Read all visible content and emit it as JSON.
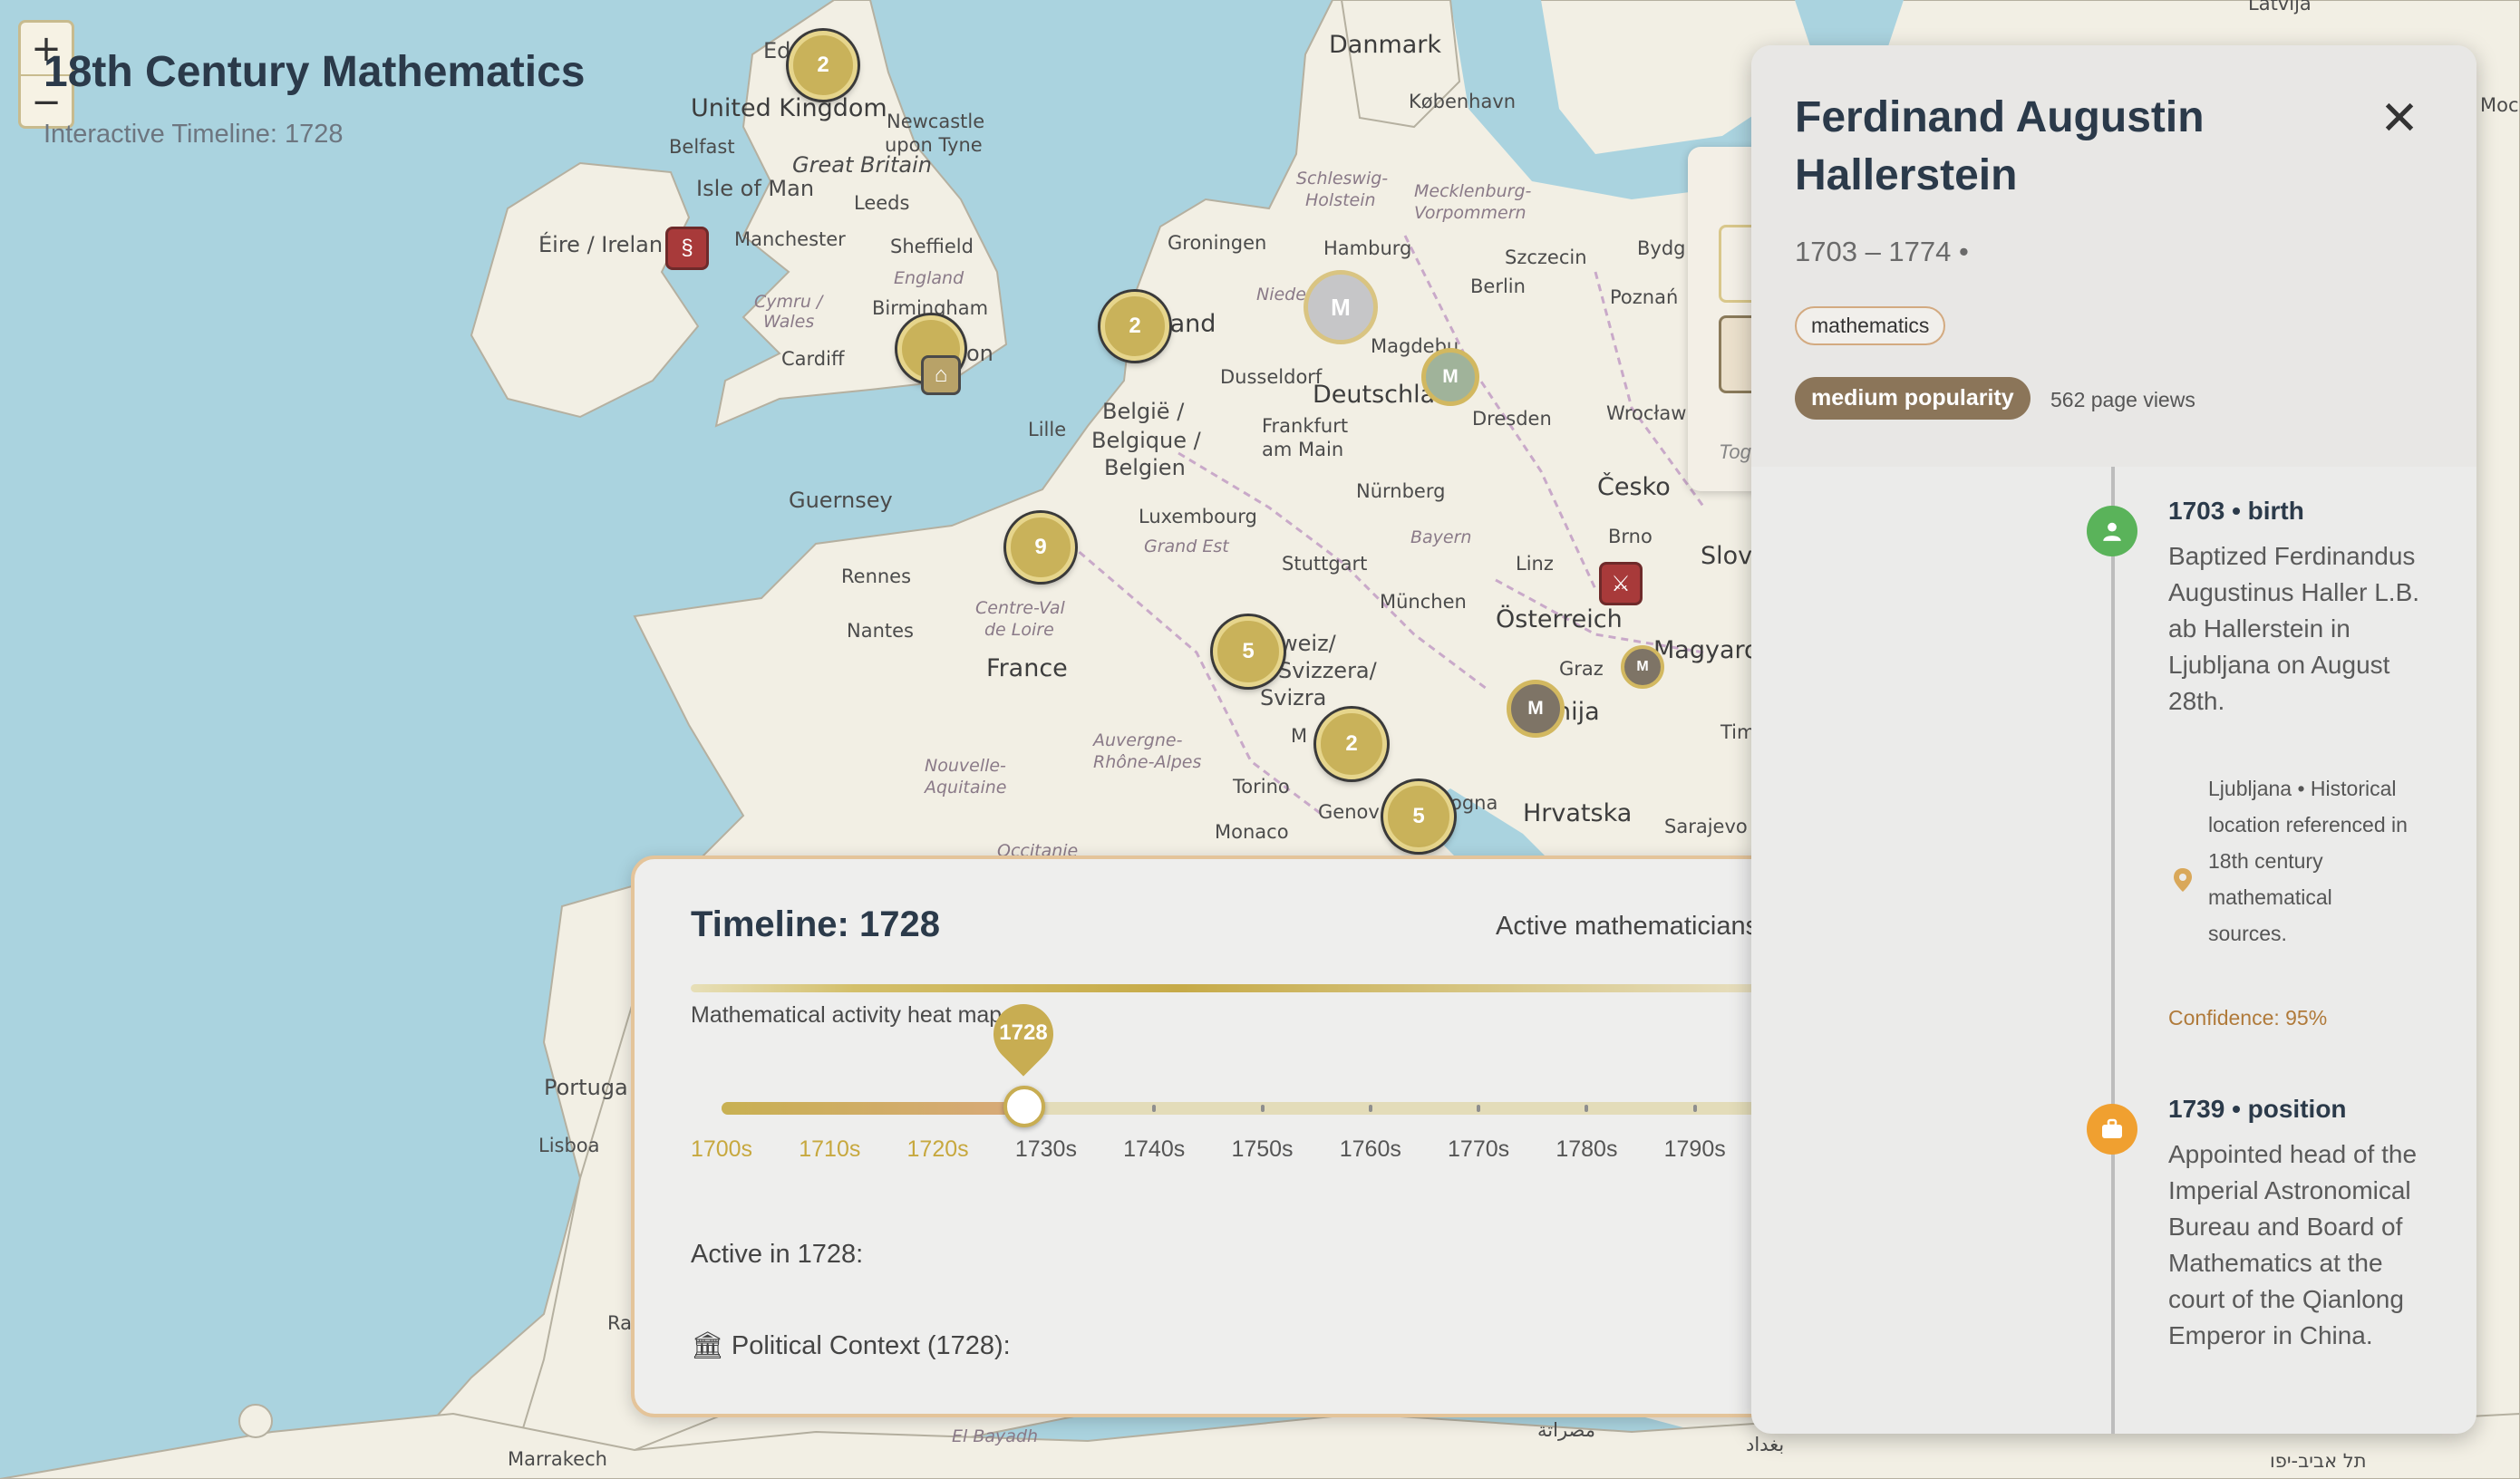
{
  "app": {
    "title": "18th Century Mathematics",
    "subtitle": "Interactive Timeline: 1728",
    "zoom_in": "+",
    "zoom_out": "−"
  },
  "map_labels": {
    "edinburgh": "Ed",
    "united_kingdom": "United Kingdom",
    "newcastle": "Newcastle",
    "upon_tyne": "upon Tyne",
    "belfast": "Belfast",
    "great_britain": "Great Britain",
    "isle_of_man": "Isle of Man",
    "leeds": "Leeds",
    "eire": "Éire / Irelan",
    "manchester": "Manchester",
    "sheffield": "Sheffield",
    "england": "England",
    "cymru": "Cymru /",
    "wales": "Wales",
    "birmingham": "Birmingham",
    "cardiff": "Cardiff",
    "london_frag": "on",
    "guernsey": "Guernsey",
    "lille": "Lille",
    "belgie1": "België /",
    "belgie2": "Belgique /",
    "belgie3": "Belgien",
    "nederland_frag": "rland",
    "dusseldorf": "Dusseldorf",
    "luxembourg": "Luxembourg",
    "grand_est": "Grand Est",
    "rennes": "Rennes",
    "centre1": "Centre-Val",
    "centre2": "de Loire",
    "nantes": "Nantes",
    "france": "France",
    "nouvelle1": "Nouvelle-",
    "nouvelle2": "Aquitaine",
    "auvergne1": "Auvergne-",
    "auvergne2": "Rhône-Alpes",
    "danmark": "Danmark",
    "kobenhavn": "København",
    "schleswig1": "Schleswig-",
    "schleswig2": "Holstein",
    "mecklenburg1": "Mecklenburg-",
    "mecklenburg2": "Vorpommern",
    "groningen": "Groningen",
    "hamburg": "Hamburg",
    "szczecin": "Szczecin",
    "bydg": "Bydg",
    "berlin": "Berlin",
    "poznan": "Poznań",
    "niede_frag": "Niede",
    "magdeburg": "Magdebu",
    "deutschland": "Deutschla",
    "dresden": "Dresden",
    "wroclaw": "Wrocław",
    "frankfurt1": "Frankfurt",
    "frankfurt2": "am Main",
    "nurnberg": "Nürnberg",
    "cesko": "Česko",
    "bayern": "Bayern",
    "brno": "Brno",
    "stuttgart": "Stuttgart",
    "linz": "Linz",
    "slove_frag": "Slove",
    "munchen": "München",
    "osterreich": "Österreich",
    "schweiz1": "weiz/",
    "schweiz2": "Svizzera/",
    "schweiz3": "Svizra",
    "graz": "Graz",
    "magyaro": "Magyaro",
    "slovenija_frag": "nija",
    "milano_frag": "M",
    "tim_frag": "Tim",
    "torino": "Torino",
    "hrvatska": "Hrvatska",
    "genova": "Genov",
    "bologna_frag": "ogna",
    "monaco": "Monaco",
    "sarajevo": "Sarajevo",
    "occitanie": "Occitanie",
    "portugal": "Portuga",
    "lisboa": "Lisboa",
    "ra_frag": "Ra",
    "marrakech": "Marrakech",
    "el_bayadh": "El Bayadh",
    "arabic_label": "مصراتة",
    "baghdad_label": "بغداد",
    "tel_aviv": "תל אביב-יפו",
    "latvija": "Latvija",
    "moscow": "Москв"
  },
  "markers": {
    "c1": "2",
    "c2": "2",
    "c3": "9",
    "c4": "5",
    "c5": "2",
    "c6": "5",
    "m_hamburg": "M",
    "m_magdeburg": "M",
    "m_graz": "M",
    "m_austria": "M"
  },
  "ghost_panel": {
    "text": "Tog"
  },
  "timeline": {
    "title": "Timeline: 1728",
    "active_count_label": "Active mathematicians",
    "heat_label": "Mathematical activity heat map",
    "selected_year": "1728",
    "slider_value": 0.2833,
    "decades": [
      "1700s",
      "1710s",
      "1720s",
      "1730s",
      "1740s",
      "1750s",
      "1760s",
      "1770s",
      "1780s",
      "1790s"
    ],
    "active_in": "Active in 1728:",
    "political_context": "🏛 Political Context (1728):"
  },
  "detail": {
    "name": "Ferdinand Augustin Hallerstein",
    "lifespan": "1703 – 1774 •",
    "tag": "mathematics",
    "popularity": "medium popularity",
    "page_views": "562 page views",
    "events": [
      {
        "title": "1703 • birth",
        "text": "Baptized Ferdinandus Augustinus Haller L.B. ab Hallerstein in Ljubljana on August 28th.",
        "location": "Ljubljana • Historical location referenced in 18th century mathematical sources.",
        "confidence": "Confidence: 95%",
        "icon": "person-icon",
        "color": "#5ab35a"
      },
      {
        "title": "1739 • position",
        "text": "Appointed head of the Imperial Astronomical Bureau and Board of Mathematics at the court of the Qianlong Emperor in China.",
        "icon": "briefcase-icon",
        "color": "#f0a030"
      }
    ]
  },
  "colors": {
    "accent": "#c8ad52",
    "popularity": "#8b7559",
    "timeline_border": "#e4c49a"
  }
}
